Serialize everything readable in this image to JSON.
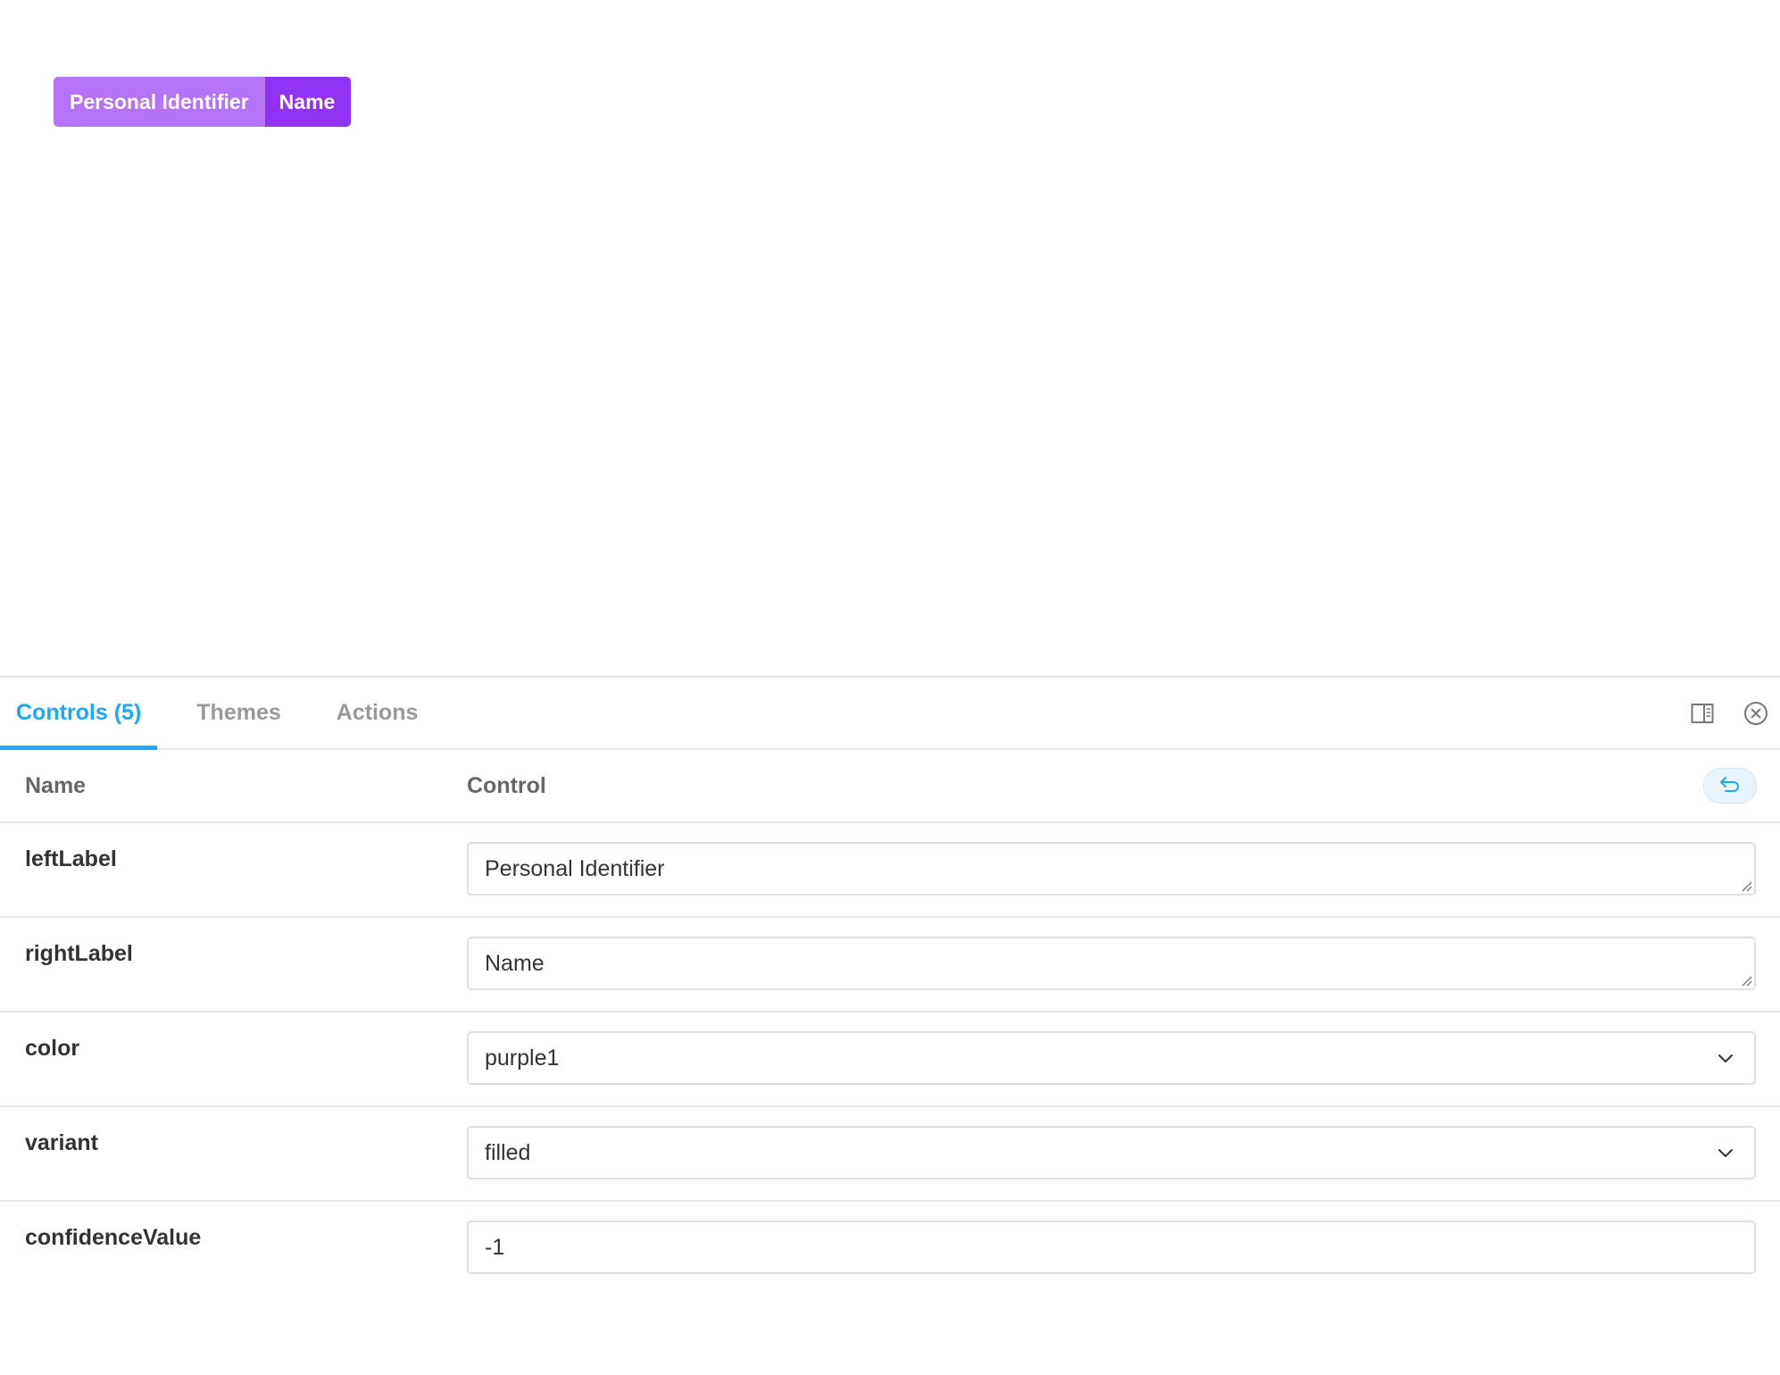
{
  "preview": {
    "badge": {
      "left_label": "Personal Identifier",
      "right_label": "Name",
      "left_color": "#b474f8",
      "right_color": "#9133f5"
    }
  },
  "addons": {
    "tabs": [
      {
        "label": "Controls (5)",
        "active": true
      },
      {
        "label": "Themes",
        "active": false
      },
      {
        "label": "Actions",
        "active": false
      }
    ],
    "icons": [
      "panel-layout-icon",
      "close-circle-icon"
    ],
    "accent_color": "#1ea7fd",
    "table": {
      "header_name": "Name",
      "header_control": "Control",
      "reset_icon": "undo-icon",
      "rows": [
        {
          "name": "leftLabel",
          "value": "Personal Identifier",
          "type": "textarea"
        },
        {
          "name": "rightLabel",
          "value": "Name",
          "type": "textarea"
        },
        {
          "name": "color",
          "value": "purple1",
          "type": "select"
        },
        {
          "name": "variant",
          "value": "filled",
          "type": "select"
        },
        {
          "name": "confidenceValue",
          "value": "-1",
          "type": "number"
        }
      ]
    }
  }
}
